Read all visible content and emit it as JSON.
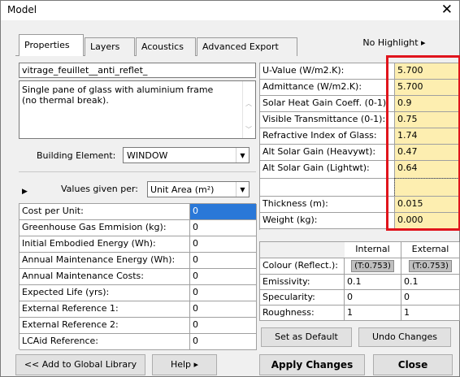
{
  "window": {
    "title": "Model"
  },
  "tabs": [
    {
      "label": "Properties"
    },
    {
      "label": "Layers"
    },
    {
      "label": "Acoustics"
    },
    {
      "label": "Advanced Export"
    }
  ],
  "highlight_button": "No Highlight ▸",
  "material": {
    "name": "vitrage_feuillet__anti_reflet_",
    "description": "Single pane of glass with aluminium frame (no thermal break).",
    "building_element_label": "Building Element:",
    "building_element_value": "WINDOW",
    "values_given_per_label": "Values given per:",
    "values_given_per_value": "Unit Area (m²)"
  },
  "cost_table": [
    {
      "label": "Cost per Unit:",
      "value": "0"
    },
    {
      "label": "Greenhouse Gas Emmision (kg):",
      "value": "0"
    },
    {
      "label": "Initial Embodied Energy (Wh):",
      "value": "0"
    },
    {
      "label": "Annual Maintenance Energy (Wh):",
      "value": "0"
    },
    {
      "label": "Annual Maintenance Costs:",
      "value": "0"
    },
    {
      "label": "Expected Life (yrs):",
      "value": "0"
    },
    {
      "label": "External Reference 1:",
      "value": "0"
    },
    {
      "label": "External Reference 2:",
      "value": "0"
    },
    {
      "label": "LCAid Reference:",
      "value": "0"
    }
  ],
  "thermal_table": [
    {
      "label": "U-Value (W/m2.K):",
      "value": "5.700"
    },
    {
      "label": "Admittance (W/m2.K):",
      "value": "5.700"
    },
    {
      "label": "Solar Heat Gain Coeff. (0-1):",
      "value": "0.9"
    },
    {
      "label": "Visible Transmittance (0-1):",
      "value": "0.75"
    },
    {
      "label": "Refractive Index of Glass:",
      "value": "1.74"
    },
    {
      "label": "Alt Solar Gain (Heavywt):",
      "value": "0.47"
    },
    {
      "label": "Alt Solar Gain (Lightwt):",
      "value": "0.64"
    },
    {
      "label": "",
      "value": ""
    },
    {
      "label": "Thickness (m):",
      "value": "0.015"
    },
    {
      "label": "Weight (kg):",
      "value": "0.000"
    }
  ],
  "surface_table": {
    "headers": [
      "Internal",
      "External"
    ],
    "rows": [
      {
        "label": "Colour (Reflect.):",
        "internal": "(T:0.753)",
        "external": "(T:0.753)"
      },
      {
        "label": "Emissivity:",
        "internal": "0.1",
        "external": "0.1"
      },
      {
        "label": "Specularity:",
        "internal": "0",
        "external": "0"
      },
      {
        "label": "Roughness:",
        "internal": "1",
        "external": "1"
      }
    ]
  },
  "buttons": {
    "set_default": "Set as Default",
    "undo_changes": "Undo Changes",
    "add_global": "<< Add to Global Library",
    "help": "Help ▸",
    "apply": "Apply Changes",
    "close": "Close"
  },
  "colors": {
    "highlight_outline": "#e0141c",
    "highlight_fill": "#fdeeb0",
    "selection": "#2a78d8"
  }
}
